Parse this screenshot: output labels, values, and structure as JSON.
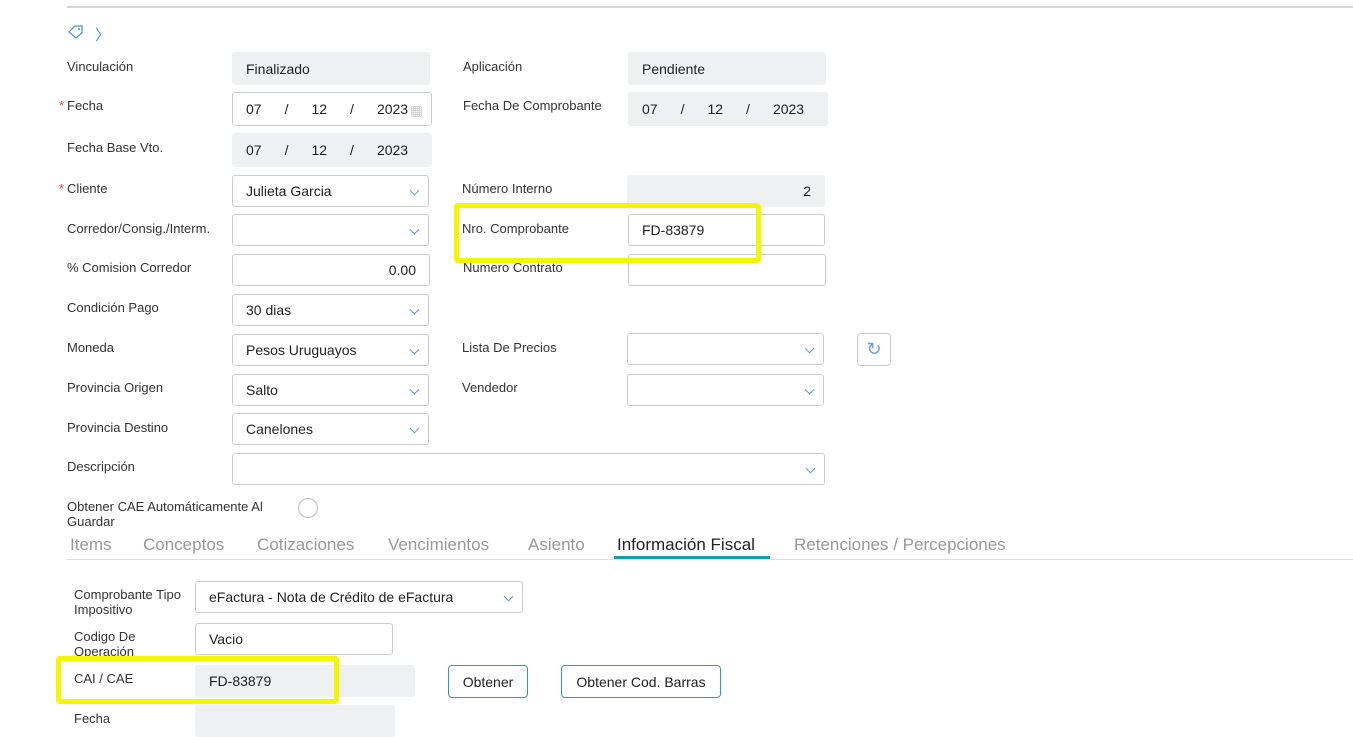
{
  "form": {
    "vinculacion": {
      "label": "Vinculación",
      "value": "Finalizado"
    },
    "aplicacion": {
      "label": "Aplicación",
      "value": "Pendiente"
    },
    "fecha": {
      "label": "Fecha",
      "dd": "07",
      "mm": "12",
      "yyyy": "2023"
    },
    "fecha_comprobante": {
      "label": "Fecha De Comprobante",
      "dd": "07",
      "mm": "12",
      "yyyy": "2023"
    },
    "fecha_base": {
      "label": "Fecha Base Vto.",
      "dd": "07",
      "mm": "12",
      "yyyy": "2023"
    },
    "cliente": {
      "label": "Cliente",
      "value": "Julieta Garcia"
    },
    "numero_interno": {
      "label": "Número Interno",
      "value": "2"
    },
    "corredor": {
      "label": "Corredor/Consig./Interm.",
      "value": ""
    },
    "nro_comprobante": {
      "label": "Nro. Comprobante",
      "value": "FD-83879"
    },
    "comision": {
      "label": "% Comision Corredor",
      "value": "0.00"
    },
    "numero_contrato": {
      "label": "Numero Contrato",
      "value": ""
    },
    "condicion_pago": {
      "label": "Condición Pago",
      "value": "30 dias"
    },
    "moneda": {
      "label": "Moneda",
      "value": "Pesos Uruguayos"
    },
    "lista_precios": {
      "label": "Lista De Precios",
      "value": ""
    },
    "provincia_origen": {
      "label": "Provincia Origen",
      "value": "Salto"
    },
    "vendedor": {
      "label": "Vendedor",
      "value": ""
    },
    "provincia_destino": {
      "label": "Provincia Destino",
      "value": "Canelones"
    },
    "descripcion": {
      "label": "Descripción",
      "value": ""
    },
    "obtener_cae": {
      "label": "Obtener CAE Automáticamente Al Guardar"
    }
  },
  "tabs": [
    "Items",
    "Conceptos",
    "Cotizaciones",
    "Vencimientos",
    "Asiento",
    "Información Fiscal",
    "Retenciones / Percepciones"
  ],
  "fiscal": {
    "tipo": {
      "label": "Comprobante Tipo Impositivo",
      "value": "eFactura - Nota de Crédito de eFactura"
    },
    "codigo": {
      "label": "Codigo De Operación",
      "value": "Vacio"
    },
    "cae": {
      "label": "CAI / CAE",
      "value": "FD-83879"
    },
    "obtener": "Obtener",
    "obtener_barras": "Obtener Cod. Barras",
    "fecha": {
      "label": "Fecha"
    }
  }
}
